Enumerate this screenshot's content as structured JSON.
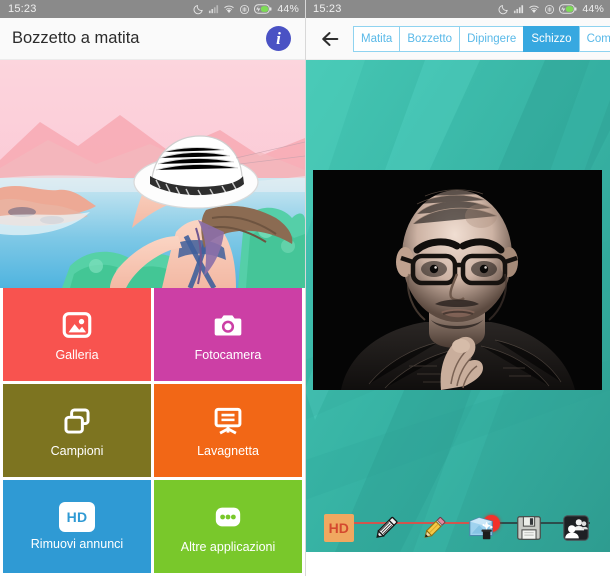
{
  "status_bar": {
    "time": "15:23",
    "battery_text": "44%",
    "icons": [
      "do-not-disturb-moon-icon",
      "signal-bars-icon",
      "wifi-icon",
      "vibrate-icon",
      "battery-charging-icon"
    ]
  },
  "left_screen": {
    "app_bar": {
      "title": "Bozzetto a matita",
      "info_label": "i",
      "info_icon": "info-circle-icon"
    },
    "hero": {
      "alt": "Illustrazione stilizzata di una donna con cappello bianco al mare",
      "icon": "hero-illustration"
    },
    "tiles": [
      {
        "label": "Galleria",
        "color": "#f8534f",
        "icon": "gallery-photo-icon"
      },
      {
        "label": "Fotocamera",
        "color": "#cc3fa5",
        "icon": "camera-icon"
      },
      {
        "label": "Campioni",
        "color": "#7d7420",
        "icon": "layers-copy-icon"
      },
      {
        "label": "Lavagnetta",
        "color": "#f26716",
        "icon": "easel-whiteboard-icon"
      },
      {
        "label": "Rimuovi annunci",
        "color": "#2f9ad4",
        "icon": "hd-badge-icon",
        "badge": "HD"
      },
      {
        "label": "Altre applicazioni",
        "color": "#79c82b",
        "icon": "more-dots-icon"
      }
    ]
  },
  "right_screen": {
    "back_icon": "back-arrow-icon",
    "tabs": [
      {
        "label": "Matita",
        "active": false
      },
      {
        "label": "Bozzetto",
        "active": false
      },
      {
        "label": "Dipingere",
        "active": false
      },
      {
        "label": "Schizzo",
        "active": true
      },
      {
        "label": "Comic",
        "active": false
      }
    ],
    "preview": {
      "alt": "Ritratto in stile schizzo di un uomo calvo con occhiali su sfondo nero",
      "icon": "portrait-sketch-preview"
    },
    "slider": {
      "name": "intensity-slider",
      "value_percent": 63,
      "min": 0,
      "max": 100
    },
    "toolbar": [
      {
        "name": "hd-button",
        "icon": "hd-badge-icon",
        "label": "HD"
      },
      {
        "name": "eraser-button",
        "icon": "pencil-eraser-icon",
        "label": ""
      },
      {
        "name": "pencil-button",
        "icon": "yellow-pencil-icon",
        "label": ""
      },
      {
        "name": "effects-button",
        "icon": "magic-folder-icon",
        "label": ""
      },
      {
        "name": "save-button",
        "icon": "floppy-disk-icon",
        "label": ""
      },
      {
        "name": "share-button",
        "icon": "share-people-icon",
        "label": ""
      }
    ]
  },
  "colors": {
    "accent_blue": "#37a8e0",
    "tab_border": "#8fd3f0",
    "teal_bg": "#3dbfae",
    "slider_red": "#f2322b",
    "status_bar": "#8a8a8a"
  }
}
